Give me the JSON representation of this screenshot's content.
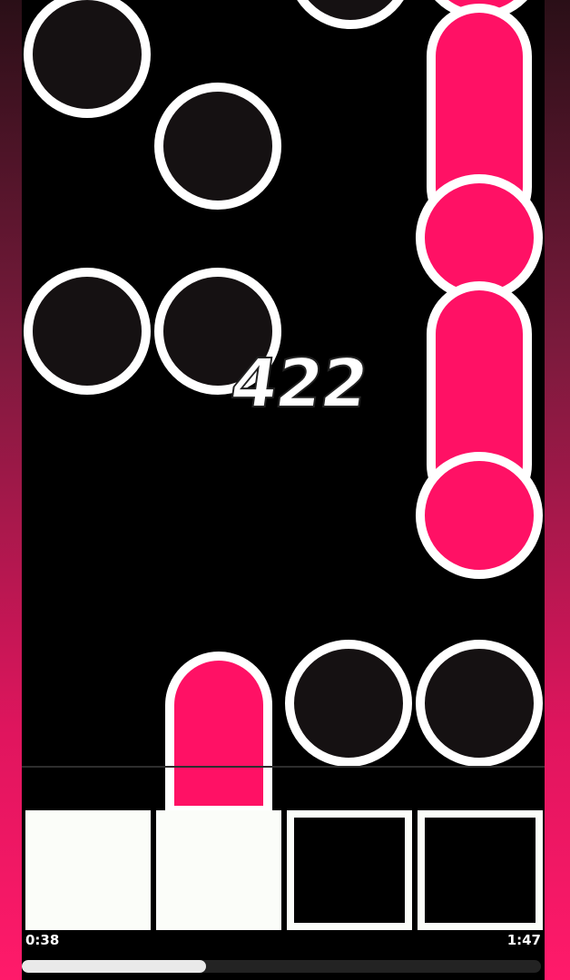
{
  "game": {
    "score": "422",
    "lanes": 4,
    "pads": [
      {
        "lane": 1,
        "state": "pressed"
      },
      {
        "lane": 2,
        "state": "pressed"
      },
      {
        "lane": 3,
        "state": "idle"
      },
      {
        "lane": 4,
        "state": "idle"
      }
    ]
  },
  "playback": {
    "elapsed": "0:38",
    "total": "1:47",
    "progress": 0.355
  },
  "colors": {
    "note_dark": "#151112",
    "note_pink": "#ff1165",
    "note_border": "#ffffff",
    "side_gradient_top": "#2a0f17",
    "side_gradient_bottom": "#ff1a6a",
    "pad_lit": "#fbfdf9"
  }
}
